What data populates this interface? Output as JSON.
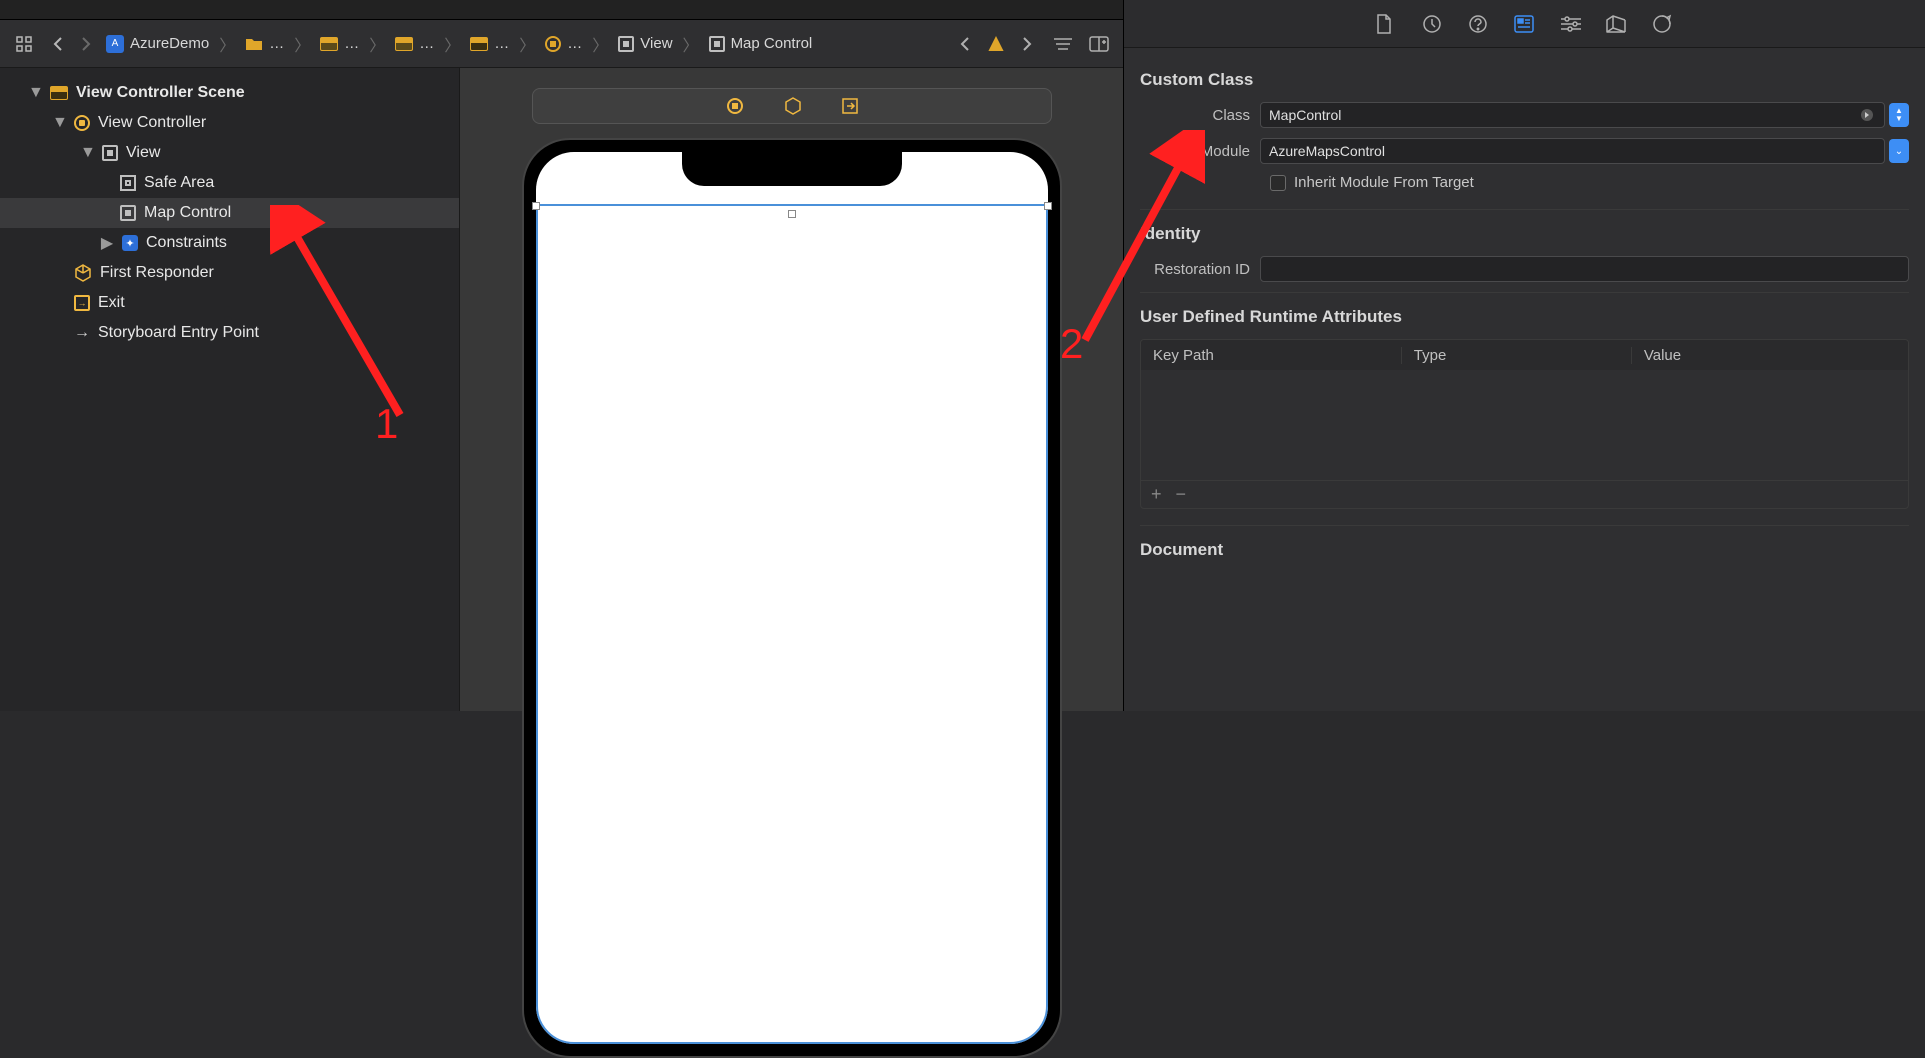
{
  "jumpbar": {
    "project": "AzureDemo",
    "crumbs": [
      "…",
      "…",
      "…",
      "…",
      "…"
    ],
    "view_crumb": "View",
    "map_crumb": "Map Control"
  },
  "outline": {
    "scene": "View Controller Scene",
    "vc": "View Controller",
    "view": "View",
    "safe_area": "Safe Area",
    "map_control": "Map Control",
    "constraints": "Constraints",
    "first_responder": "First Responder",
    "exit": "Exit",
    "entry_point": "Storyboard Entry Point"
  },
  "inspector": {
    "section_custom_class": "Custom Class",
    "class_label": "Class",
    "class_value": "MapControl",
    "module_label": "Module",
    "module_value": "AzureMapsControl",
    "inherit_label": "Inherit Module From Target",
    "section_identity": "Identity",
    "restoration_label": "Restoration ID",
    "restoration_value": "",
    "section_uda": "User Defined Runtime Attributes",
    "col_keypath": "Key Path",
    "col_type": "Type",
    "col_value": "Value",
    "section_document": "Document"
  },
  "annotations": {
    "label1": "1",
    "label2": "2"
  }
}
